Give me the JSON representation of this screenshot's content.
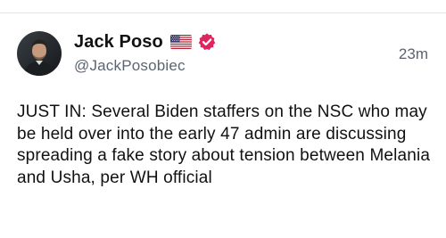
{
  "post": {
    "author": {
      "display_name": "Jack Poso",
      "handle": "@JackPosobiec",
      "flag_icon": "us-flag-icon",
      "verified_icon": "verified-badge-icon",
      "verified_color": "#e0245e",
      "avatar": "profile-photo"
    },
    "timestamp": "23m",
    "text": "JUST IN: Several Biden staffers on the NSC who may be held over into the early 47 admin are discussing spreading a fake story about tension between Melania and Usha, per WH official"
  }
}
